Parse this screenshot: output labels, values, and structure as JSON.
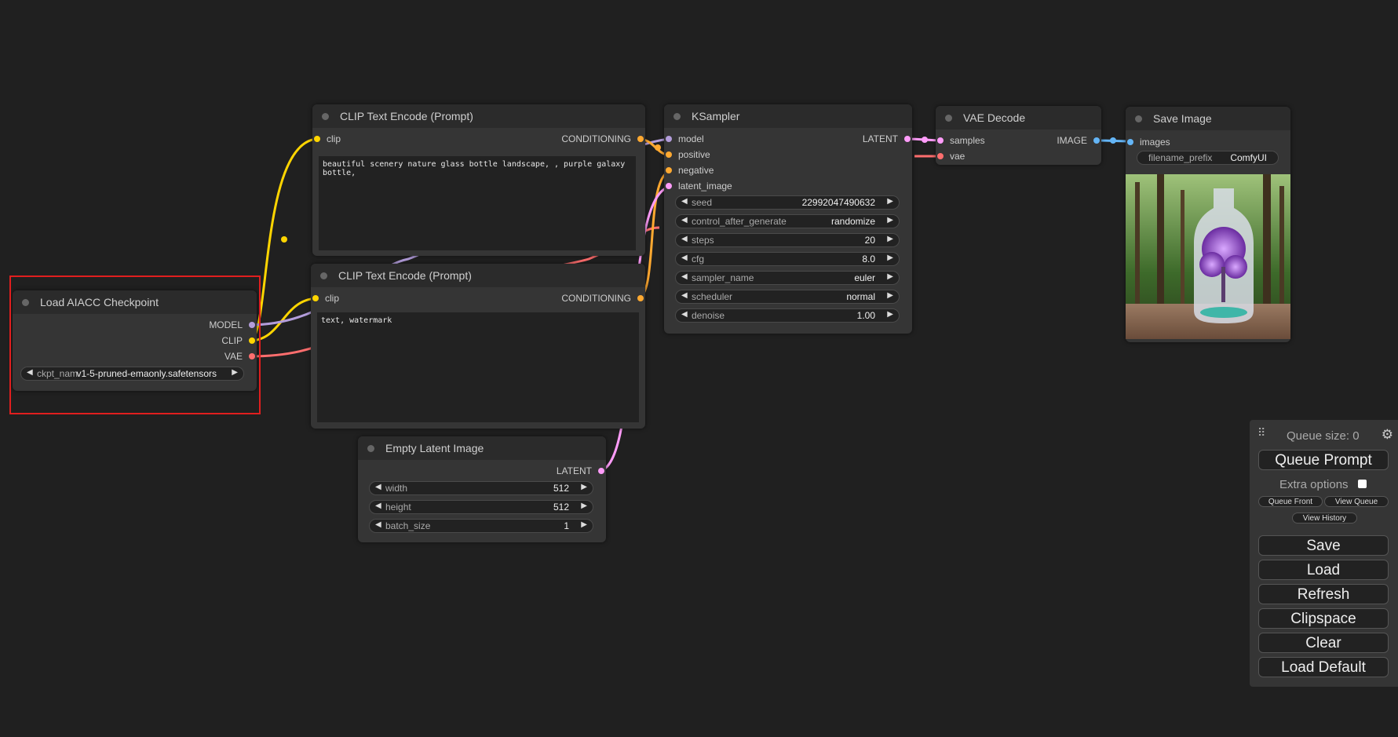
{
  "colors": {
    "background": "#202020",
    "node_body": "#353535",
    "node_title": "#2b2b2b",
    "selection": "#e01e1e",
    "model": "#b39ddb",
    "clip": "#ffd500",
    "vae": "#ff6e6e",
    "conditioning": "#ffa931",
    "latent": "#ff9cf9",
    "image": "#64b5f6"
  },
  "nodes": {
    "clip_pos": {
      "title": "CLIP Text Encode (Prompt)",
      "input_clip": "clip",
      "output": "CONDITIONING",
      "text": "beautiful scenery nature glass bottle landscape, , purple galaxy bottle,"
    },
    "clip_neg": {
      "title": "CLIP Text Encode (Prompt)",
      "input_clip": "clip",
      "output": "CONDITIONING",
      "text": "text, watermark"
    },
    "checkpoint": {
      "title": "Load AIACC Checkpoint",
      "out_model": "MODEL",
      "out_clip": "CLIP",
      "out_vae": "VAE",
      "ckpt_label": "ckpt_nam",
      "ckpt_value": "v1-5-pruned-emaonly.safetensors"
    },
    "latent": {
      "title": "Empty Latent Image",
      "output": "LATENT",
      "widgets": [
        {
          "label": "width",
          "value": "512"
        },
        {
          "label": "height",
          "value": "512"
        },
        {
          "label": "batch_size",
          "value": "1"
        }
      ]
    },
    "ksampler": {
      "title": "KSampler",
      "in_model": "model",
      "in_positive": "positive",
      "in_negative": "negative",
      "in_latent": "latent_image",
      "output": "LATENT",
      "widgets": [
        {
          "label": "seed",
          "value": "22992047490632"
        },
        {
          "label": "control_after_generate",
          "value": "randomize"
        },
        {
          "label": "steps",
          "value": "20"
        },
        {
          "label": "cfg",
          "value": "8.0"
        },
        {
          "label": "sampler_name",
          "value": "euler"
        },
        {
          "label": "scheduler",
          "value": "normal"
        },
        {
          "label": "denoise",
          "value": "1.00"
        }
      ]
    },
    "vae_decode": {
      "title": "VAE Decode",
      "in_samples": "samples",
      "in_vae": "vae",
      "output": "IMAGE"
    },
    "save_image": {
      "title": "Save Image",
      "in_images": "images",
      "prefix_label": "filename_prefix",
      "prefix_value": "ComfyUI"
    }
  },
  "queue": {
    "size_label": "Queue size: 0",
    "queue_prompt": "Queue Prompt",
    "extra_options": "Extra options",
    "queue_front": "Queue Front",
    "view_queue": "View Queue",
    "view_history": "View History",
    "save": "Save",
    "load": "Load",
    "refresh": "Refresh",
    "clipspace": "Clipspace",
    "clear": "Clear",
    "load_default": "Load Default"
  },
  "icons": {
    "drag": "drag-handle-icon",
    "settings": "gear-icon",
    "arrow_left": "arrow-left-icon",
    "arrow_right": "arrow-right-icon"
  }
}
